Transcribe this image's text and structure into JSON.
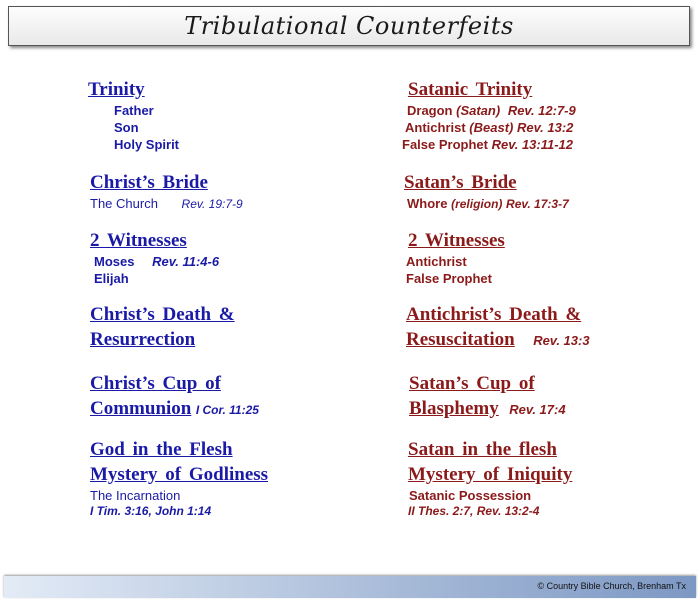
{
  "title": "Tribulational Counterfeits",
  "left": {
    "trinity": {
      "heading": "Trinity",
      "items": [
        "Father",
        "Son",
        "Holy  Spirit"
      ]
    },
    "bride": {
      "heading": "Christ’s  Bride",
      "line_text": "The Church",
      "line_ref": "Rev. 19:7-9"
    },
    "witnesses": {
      "heading": "2  Witnesses",
      "moses": "Moses",
      "moses_ref": "Rev. 11:4-6",
      "elijah": "Elijah"
    },
    "death": {
      "line1": "Christ’s  Death  &",
      "line2": "Resurrection"
    },
    "cup": {
      "line1": "Christ’s  Cup  of",
      "line2": "Communion",
      "ref": "I Cor. 11:25"
    },
    "flesh": {
      "line1": "God  in  the  Flesh",
      "line2": "Mystery of Godliness",
      "sub": "The Incarnation",
      "ref": "I Tim. 3:16,  John 1:14"
    }
  },
  "right": {
    "trinity": {
      "heading": "Satanic  Trinity",
      "dragon": "Dragon",
      "dragon_paren": "(Satan)",
      "dragon_ref": "Rev. 12:7-9",
      "antichrist": "Antichrist",
      "antichrist_paren": "(Beast)",
      "antichrist_ref": "Rev. 13:2",
      "prophet": "False  Prophet",
      "prophet_ref": "Rev. 13:11-12"
    },
    "bride": {
      "heading": "Satan’s  Bride",
      "line_text": "Whore",
      "line_paren": "(religion)",
      "line_ref": "Rev. 17:3-7"
    },
    "witnesses": {
      "heading": "2  Witnesses",
      "items": [
        "Antichrist",
        "False  Prophet"
      ]
    },
    "death": {
      "line1": "Antichrist’s  Death  &",
      "line2": "Resuscitation",
      "ref": "Rev. 13:3"
    },
    "cup": {
      "line1": "Satan’s  Cup   of",
      "line2": "Blasphemy",
      "ref": "Rev. 17:4"
    },
    "flesh": {
      "line1": "Satan  in  the  flesh",
      "line2": "Mystery  of   Iniquity",
      "sub": "Satanic Possession",
      "ref": "II Thes. 2:7,  Rev. 13:2-4"
    }
  },
  "footer": "© Country Bible Church, Brenham Tx",
  "colors": {
    "left": "#1a1aa6",
    "right": "#8b1a1a"
  }
}
